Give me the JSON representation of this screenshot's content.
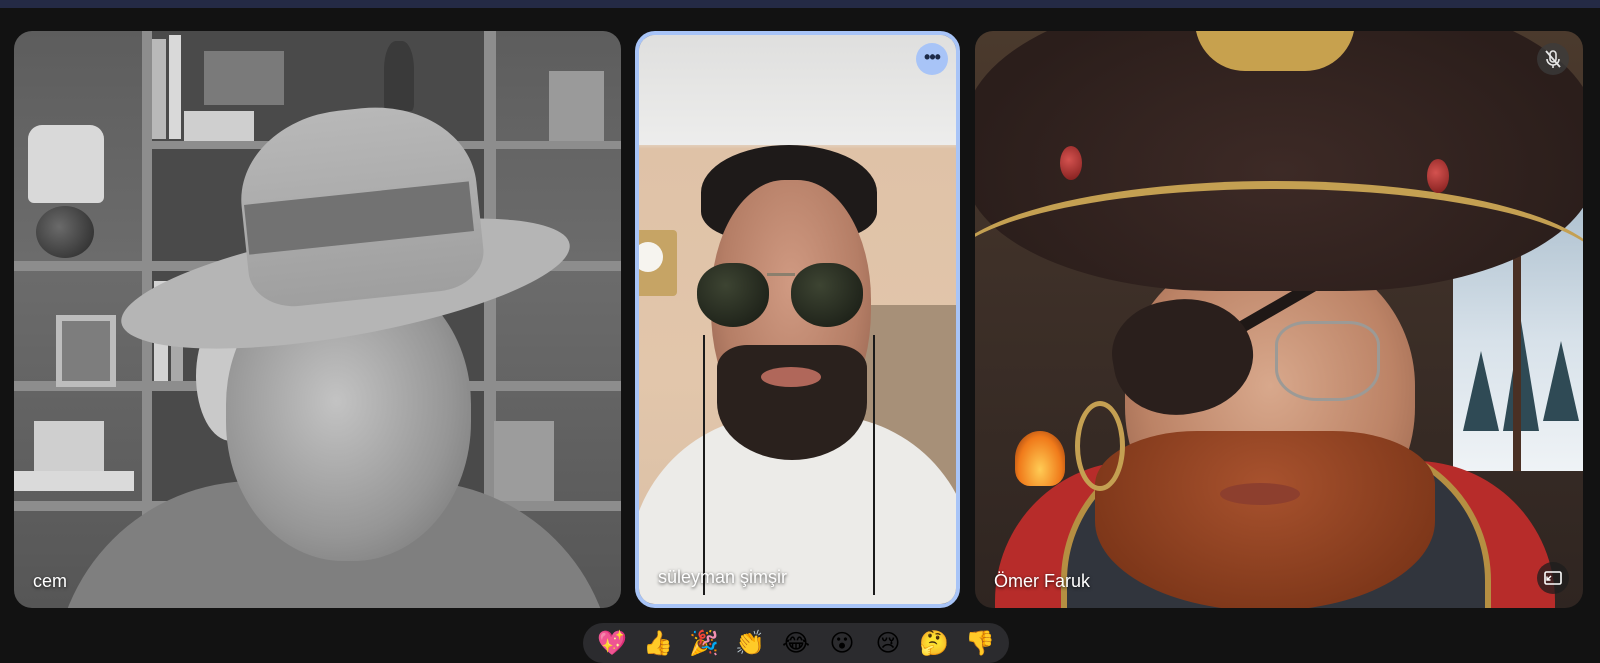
{
  "participants": [
    {
      "name": "cem"
    },
    {
      "name": "süleyman şimşir"
    },
    {
      "name": "Ömer Faruk"
    }
  ],
  "icons": {
    "more_options": "more-options-icon",
    "mic_off": "mic-off-icon",
    "pip": "picture-in-picture-icon"
  },
  "reactions": [
    "💖",
    "👍",
    "🎉",
    "👏",
    "😂",
    "😮",
    "😢",
    "🤔",
    "👎"
  ],
  "colors": {
    "active_speaker_border": "#a8c4f7",
    "background": "#121212"
  }
}
